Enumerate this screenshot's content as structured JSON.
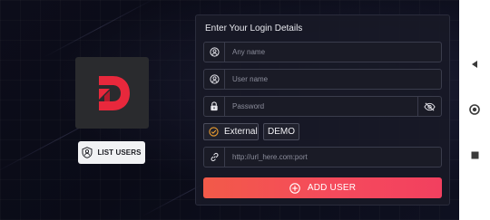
{
  "form": {
    "title": "Enter Your Login Details",
    "name_placeholder": "Any name",
    "username_placeholder": "User name",
    "password_placeholder": "Password",
    "url_placeholder": "http://url_here.com:port",
    "name_value": "",
    "username_value": "",
    "password_value": "",
    "url_value": ""
  },
  "options": {
    "external_label": "External",
    "demo_label": "DEMO",
    "external_selected": true
  },
  "buttons": {
    "list_users_label": "LIST USERS",
    "add_user_label": "ADD USER"
  },
  "icons": {
    "logo": "d-logo-icon",
    "list_users": "user-badge-icon",
    "name_field": "user-circle-icon",
    "username_field": "user-circle-icon",
    "password_field": "lock-icon",
    "password_toggle": "eye-off-icon",
    "external_check": "check-circle-icon",
    "url_field": "link-icon",
    "add_user": "plus-circle-icon",
    "nav_back": "triangle-back-icon",
    "nav_home": "circle-home-icon",
    "nav_recents": "square-recents-icon"
  },
  "colors": {
    "accent_start": "#f25a49",
    "accent_end": "#f2405f",
    "logo_red": "#e8283c",
    "check_orange": "#f0a030",
    "background": "#0b0c17",
    "panel": "#181926"
  }
}
